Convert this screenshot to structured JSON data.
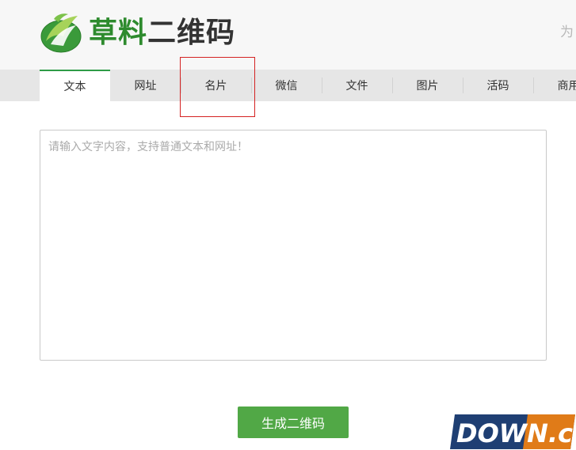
{
  "header": {
    "logo": {
      "part1": "草料",
      "part2": "二维码"
    },
    "right_text": "为"
  },
  "tabs": [
    {
      "label": "文本",
      "active": true
    },
    {
      "label": "网址",
      "active": false
    },
    {
      "label": "名片",
      "active": false,
      "highlighted": true
    },
    {
      "label": "微信",
      "active": false
    },
    {
      "label": "文件",
      "active": false
    },
    {
      "label": "图片",
      "active": false
    },
    {
      "label": "活码",
      "active": false
    },
    {
      "label": "商用",
      "active": false
    }
  ],
  "editor": {
    "value": "",
    "placeholder": "请输入文字内容，支持普通文本和网址！"
  },
  "generate_button": {
    "label": "生成二维码"
  },
  "watermark": {
    "text": "DOWN.cc"
  },
  "colors": {
    "brand_green": "#2e8b2e",
    "button_green": "#51a846",
    "tab_active_border": "#2e9b47",
    "highlight_red": "#d42222"
  }
}
